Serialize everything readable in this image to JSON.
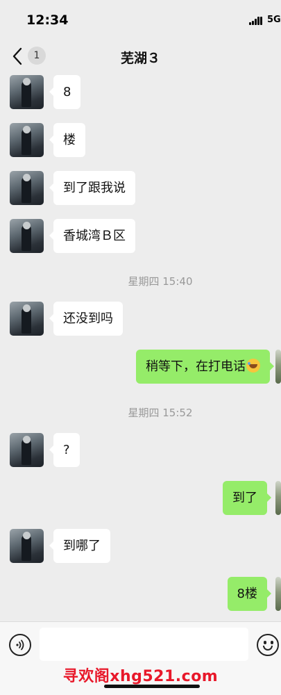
{
  "status_bar": {
    "time": "12:34",
    "network": "5G"
  },
  "nav": {
    "unread_count": "1",
    "title": "芜湖３"
  },
  "messages": [
    {
      "from": "them",
      "text": "8"
    },
    {
      "from": "them",
      "text": "楼"
    },
    {
      "from": "them",
      "text": "到了跟我说"
    },
    {
      "from": "them",
      "text": "香城湾Ｂ区"
    },
    {
      "type": "time",
      "text": "星期四 15:40"
    },
    {
      "from": "them",
      "text": "还没到吗"
    },
    {
      "from": "me",
      "text": "稍等下，在打电话",
      "emoji": "laugh-tears-emoji"
    },
    {
      "type": "time",
      "text": "星期四 15:52"
    },
    {
      "from": "them",
      "text": "?"
    },
    {
      "from": "me",
      "text": "到了"
    },
    {
      "from": "them",
      "text": "到哪了"
    },
    {
      "from": "me",
      "text": "8楼"
    }
  ],
  "input": {
    "value": "",
    "placeholder": ""
  },
  "watermark": "寻欢阁xhg521.com",
  "colors": {
    "background": "#ededed",
    "outgoing_bubble": "#95ec69",
    "incoming_bubble": "#ffffff",
    "watermark": "#e8182a"
  }
}
